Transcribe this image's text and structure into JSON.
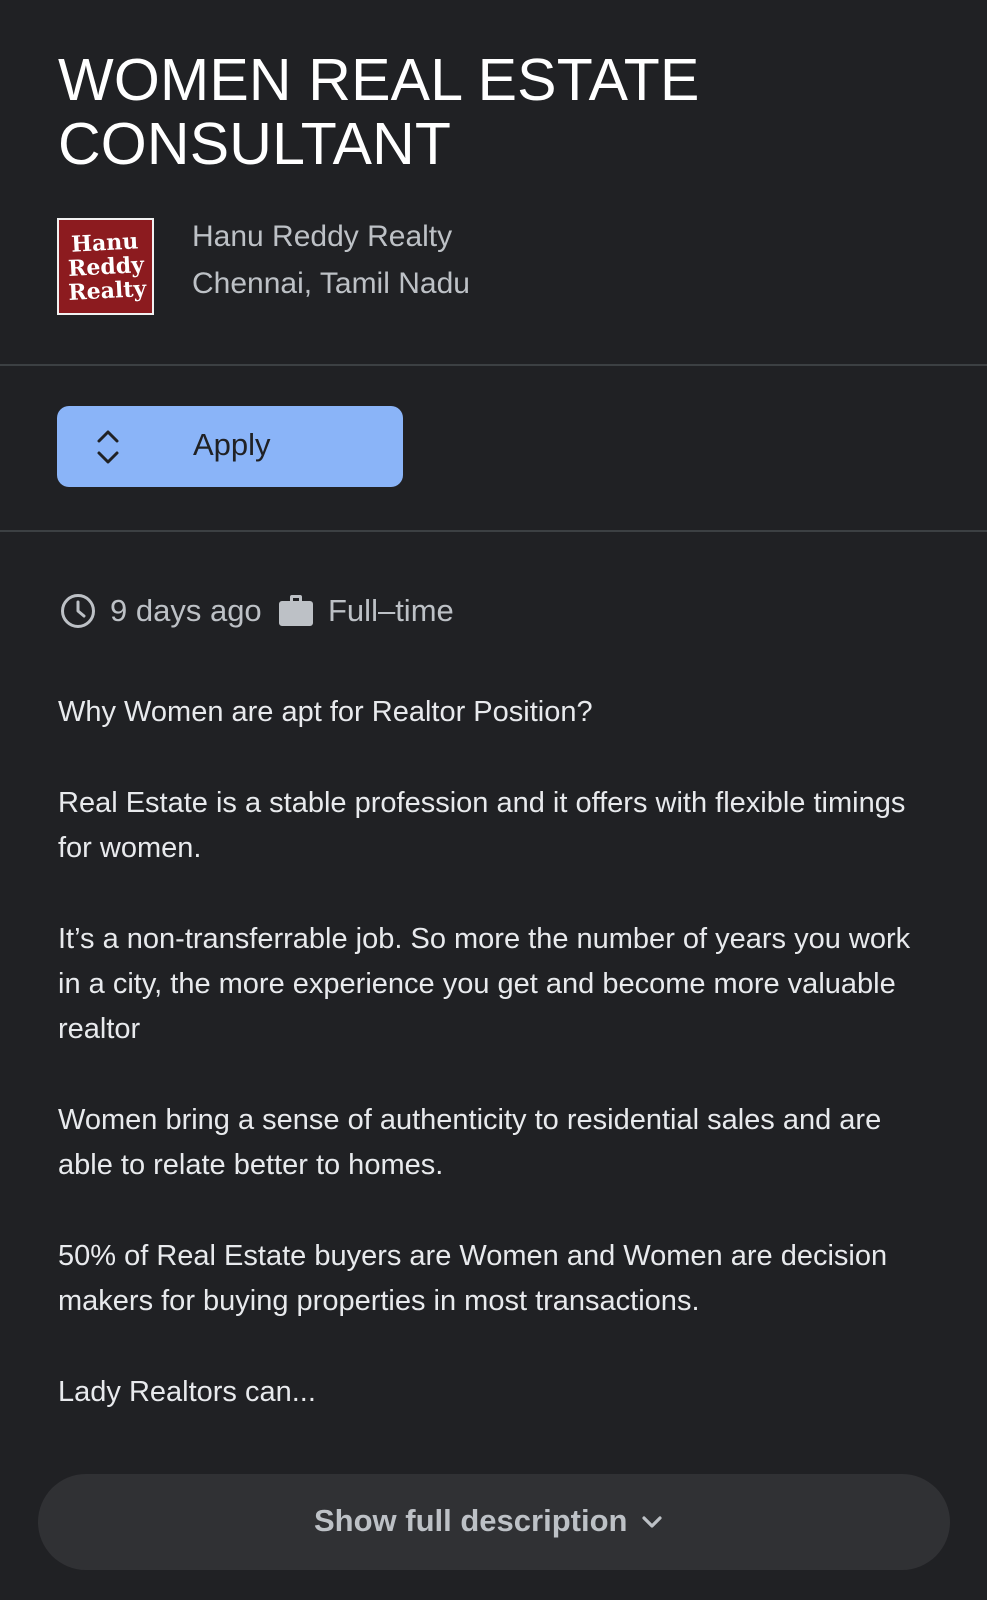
{
  "job": {
    "title": "WOMEN REAL ESTATE CONSULTANT",
    "company_name": "Hanu Reddy Realty",
    "location": "Chennai, Tamil Nadu",
    "logo_text": "Hanu Reddy Realty"
  },
  "apply": {
    "label": "Apply",
    "icon": "unfold-more-icon"
  },
  "meta": {
    "posted": "9 days ago",
    "posted_icon": "clock-icon",
    "job_type": "Full–time",
    "job_type_icon": "briefcase-icon"
  },
  "description": {
    "paragraphs": [
      "Why Women are apt for Realtor Position?",
      "Real Estate is a stable profession and it offers with flexible timings for women.",
      "It’s a non-transferrable job. So more the number of years you work in a city, the more experience you get and become more valuable realtor",
      "Women bring a sense of authenticity to residential sales and are able to relate better to homes.",
      "50% of Real Estate buyers are Women and Women are decision makers for buying properties in most transactions.",
      "Lady Realtors can..."
    ]
  },
  "show_more": {
    "label": "Show full description",
    "icon": "chevron-down-icon"
  },
  "colors": {
    "background": "#202124",
    "apply_button": "#8ab4f8",
    "show_more_bg": "#303134",
    "logo_bg": "#8c1b1f"
  }
}
